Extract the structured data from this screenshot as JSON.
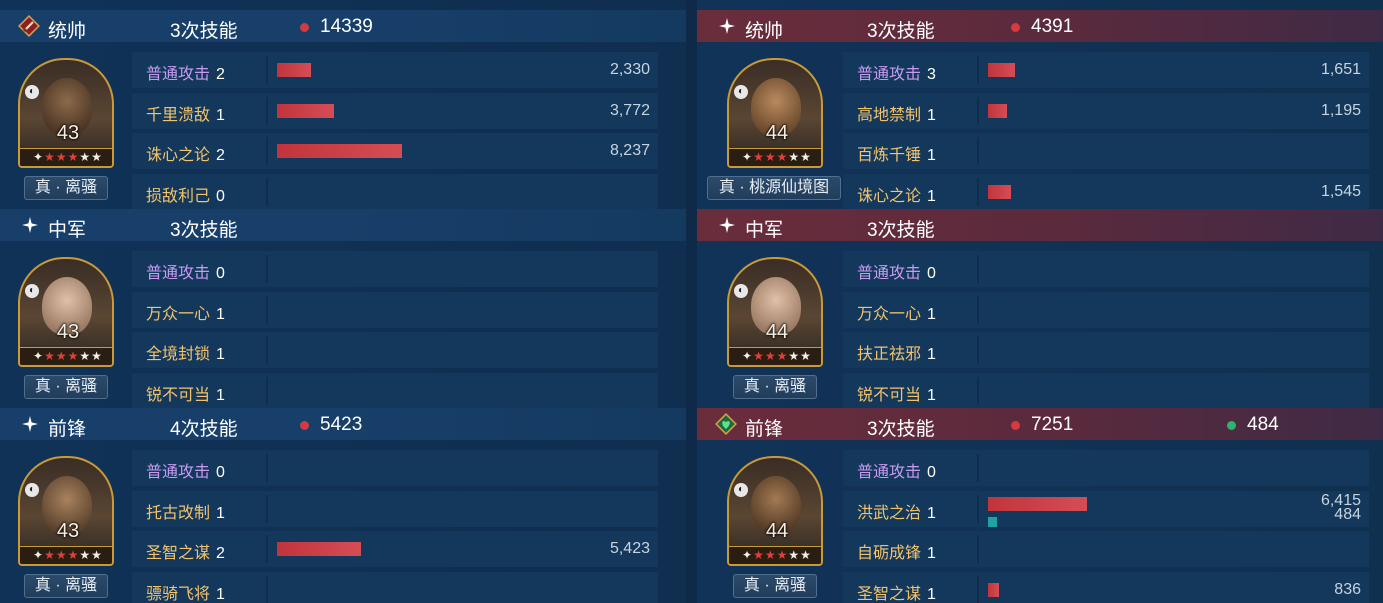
{
  "left": {
    "sections": [
      {
        "role": "统帅",
        "skills_count": "3次技能",
        "damage": "14339",
        "level": "43",
        "stars_lit": 3,
        "book": "真 · 离骚",
        "skills": [
          {
            "name": "普通攻击",
            "level": "2",
            "basic": true,
            "bar_pct": 9,
            "value": "2,330"
          },
          {
            "name": "千里溃敌",
            "level": "1",
            "bar_pct": 15,
            "value": "3,772"
          },
          {
            "name": "诛心之论",
            "level": "2",
            "bar_pct": 33,
            "value": "8,237"
          },
          {
            "name": "损敌利己",
            "level": "0",
            "bar_pct": 0,
            "value": ""
          }
        ]
      },
      {
        "role": "中军",
        "skills_count": "3次技能",
        "damage": "",
        "level": "43",
        "stars_lit": 3,
        "book": "真 · 离骚",
        "skills": [
          {
            "name": "普通攻击",
            "level": "0",
            "basic": true,
            "bar_pct": 0,
            "value": ""
          },
          {
            "name": "万众一心",
            "level": "1",
            "bar_pct": 0,
            "value": ""
          },
          {
            "name": "全境封锁",
            "level": "1",
            "bar_pct": 0,
            "value": ""
          },
          {
            "name": "锐不可当",
            "level": "1",
            "bar_pct": 0,
            "value": ""
          }
        ]
      },
      {
        "role": "前锋",
        "skills_count": "4次技能",
        "damage": "5423",
        "level": "43",
        "stars_lit": 3,
        "book": "真 · 离骚",
        "skills": [
          {
            "name": "普通攻击",
            "level": "0",
            "basic": true,
            "bar_pct": 0,
            "value": ""
          },
          {
            "name": "托古改制",
            "level": "1",
            "bar_pct": 0,
            "value": ""
          },
          {
            "name": "圣智之谋",
            "level": "2",
            "bar_pct": 22,
            "value": "5,423"
          },
          {
            "name": "骠骑飞将",
            "level": "1",
            "bar_pct": 0,
            "value": ""
          }
        ]
      }
    ]
  },
  "right": {
    "sections": [
      {
        "role": "统帅",
        "skills_count": "3次技能",
        "damage": "4391",
        "level": "44",
        "stars_lit": 3,
        "book": "真 · 桃源仙境图",
        "skills": [
          {
            "name": "普通攻击",
            "level": "3",
            "basic": true,
            "bar_pct": 7,
            "value": "1,651"
          },
          {
            "name": "高地禁制",
            "level": "1",
            "bar_pct": 5,
            "value": "1,195"
          },
          {
            "name": "百炼千锤",
            "level": "1",
            "bar_pct": 0,
            "value": ""
          },
          {
            "name": "诛心之论",
            "level": "1",
            "bar_pct": 6,
            "value": "1,545"
          }
        ]
      },
      {
        "role": "中军",
        "skills_count": "3次技能",
        "damage": "",
        "level": "44",
        "stars_lit": 3,
        "book": "真 · 离骚",
        "skills": [
          {
            "name": "普通攻击",
            "level": "0",
            "basic": true,
            "bar_pct": 0,
            "value": ""
          },
          {
            "name": "万众一心",
            "level": "1",
            "bar_pct": 0,
            "value": ""
          },
          {
            "name": "扶正祛邪",
            "level": "1",
            "bar_pct": 0,
            "value": ""
          },
          {
            "name": "锐不可当",
            "level": "1",
            "bar_pct": 0,
            "value": ""
          }
        ]
      },
      {
        "role": "前锋",
        "skills_count": "3次技能",
        "damage": "7251",
        "heal": "484",
        "level": "44",
        "stars_lit": 3,
        "book": "真 · 离骚",
        "skills": [
          {
            "name": "普通攻击",
            "level": "0",
            "basic": true,
            "bar_pct": 0,
            "value": ""
          },
          {
            "name": "洪武之治",
            "level": "1",
            "bar_pct": 26,
            "value": "6,415",
            "heal_value": "484"
          },
          {
            "name": "自砺成锋",
            "level": "1",
            "bar_pct": 0,
            "value": ""
          },
          {
            "name": "圣智之谋",
            "level": "1",
            "bar_pct": 3,
            "value": "836"
          }
        ]
      }
    ]
  },
  "colors": {
    "damage_dot": "#d43a3f",
    "heal_dot": "#2eb46a",
    "damage_bar": "#c2343c",
    "heal_bar": "#1fa3a0",
    "basic_skill": "#c89bf0",
    "skill": "#f2c36b"
  },
  "icons": {
    "left_commander": "red-sword-badge-icon",
    "right_vanguard": "green-heart-badge-icon",
    "default_role": "sparkle-icon",
    "tactic": "tactic-badge-icon",
    "star": "star-icon"
  }
}
